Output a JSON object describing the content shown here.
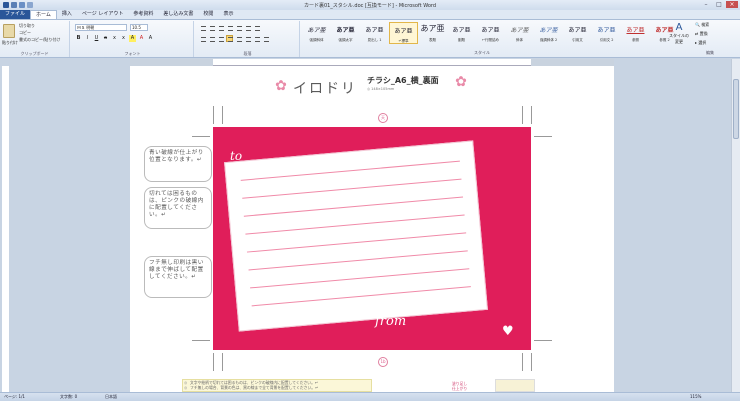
{
  "window": {
    "title": "カード裏01_スタシル.doc [互換モード] - Microsoft Word"
  },
  "tabs": [
    "ファイル",
    "ホーム",
    "挿入",
    "ページ レイアウト",
    "参考資料",
    "差し込み文書",
    "校閲",
    "表示"
  ],
  "ribbon": {
    "clipboard": {
      "paste": "貼り付け",
      "cut": "切り取り",
      "copy": "コピー",
      "format_painter": "書式のコピー/貼り付け",
      "label": "クリップボード"
    },
    "font": {
      "name": "ＭＳ 明朝",
      "size": "10.5",
      "label": "フォント"
    },
    "paragraph": {
      "label": "段落"
    },
    "styles": {
      "label": "スタイル",
      "items": [
        {
          "preview": "あア亜",
          "name": "強調斜体"
        },
        {
          "preview": "あア亜",
          "name": "強調太字"
        },
        {
          "preview": "あア亜",
          "name": "見出し 1"
        },
        {
          "preview": "あア亜",
          "name": "↵標準",
          "selected": true
        },
        {
          "preview": "あア亜",
          "name": "表題"
        },
        {
          "preview": "あア亜",
          "name": "副題"
        },
        {
          "preview": "あア亜",
          "name": "↵行間詰め"
        },
        {
          "preview": "あア亜",
          "name": "斜体"
        },
        {
          "preview": "あア亜",
          "name": "強調斜体 2"
        },
        {
          "preview": "あア亜",
          "name": "引用文"
        },
        {
          "preview": "あア亜",
          "name": "引用文 2"
        },
        {
          "preview": "あア亜",
          "name": "参照"
        },
        {
          "preview": "あア亜",
          "name": "参照 2"
        }
      ],
      "change_label": "スタイルの変更"
    },
    "editing": {
      "label": "編集",
      "find": "検索",
      "replace": "置換",
      "select": "選択"
    }
  },
  "document": {
    "logo": "イロドリ",
    "title": "チラシ_A6_横_裏面",
    "subtitle": "◎ 148×105mm",
    "top_mark": "天",
    "bottom_mark": "1b",
    "card": {
      "to": "to",
      "from": "from"
    },
    "callouts": [
      "青い破線が仕上がり位置となります。↵",
      "切れては困るものは、ピンクの破線内に配置してください。↵",
      "フチ無し印刷は黒い線まで伸ばして配置してください。↵"
    ],
    "notes": [
      "文字や絵柄で切れては困るものは、ピンクの破線内に配置してください。↵",
      "フチ無しの場合、背景の色は、黒の線まで全て背景を配置してください。↵"
    ],
    "legend": [
      "塗り足し",
      "仕上がり"
    ]
  },
  "statusbar": {
    "page": "ページ: 1/1",
    "words": "文字数: 0",
    "lang": "日本語",
    "zoom": "115%"
  },
  "colors": {
    "card": "#e01e5a",
    "rule": "#f08aa8"
  }
}
